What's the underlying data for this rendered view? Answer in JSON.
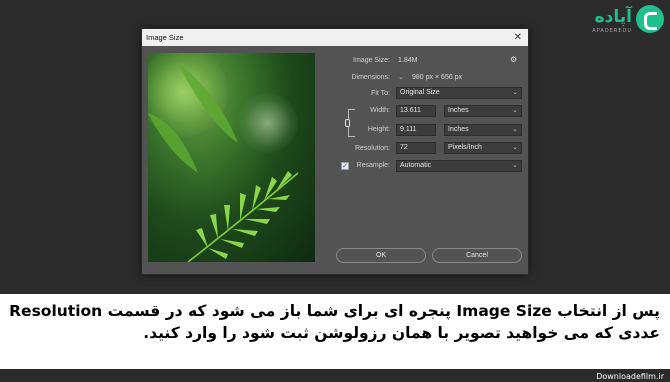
{
  "logo": {
    "word": "آپاده",
    "sub": "APADEREDU"
  },
  "dialog": {
    "title": "Image Size",
    "close_glyph": "✕",
    "image_size": {
      "label": "Image Size:",
      "value": "1.84M"
    },
    "dimensions": {
      "label": "Dimensions:",
      "width": "980",
      "unit1": "px",
      "x": "×",
      "height": "656",
      "unit2": "px"
    },
    "fit_to": {
      "label": "Fit To:",
      "value": "Original Size"
    },
    "width": {
      "label": "Width:",
      "value": "13.611",
      "unit": "Inches"
    },
    "height": {
      "label": "Height:",
      "value": "9.111",
      "unit": "Inches"
    },
    "resolution": {
      "label": "Resolution:",
      "value": "72",
      "unit": "Pixels/Inch"
    },
    "resample": {
      "label": "Resample:",
      "checked": true,
      "value": "Automatic"
    },
    "ok_label": "OK",
    "cancel_label": "Cancel"
  },
  "caption": {
    "line1": "پس از انتخاب Image Size  پنجره ای برای شما باز می شود که در قسمت Resolution",
    "line2": "عددی که می خواهید تصویر با همان رزولوشن ثبت شود را وارد کنید."
  },
  "watermark": "Downloadefilm.ir"
}
